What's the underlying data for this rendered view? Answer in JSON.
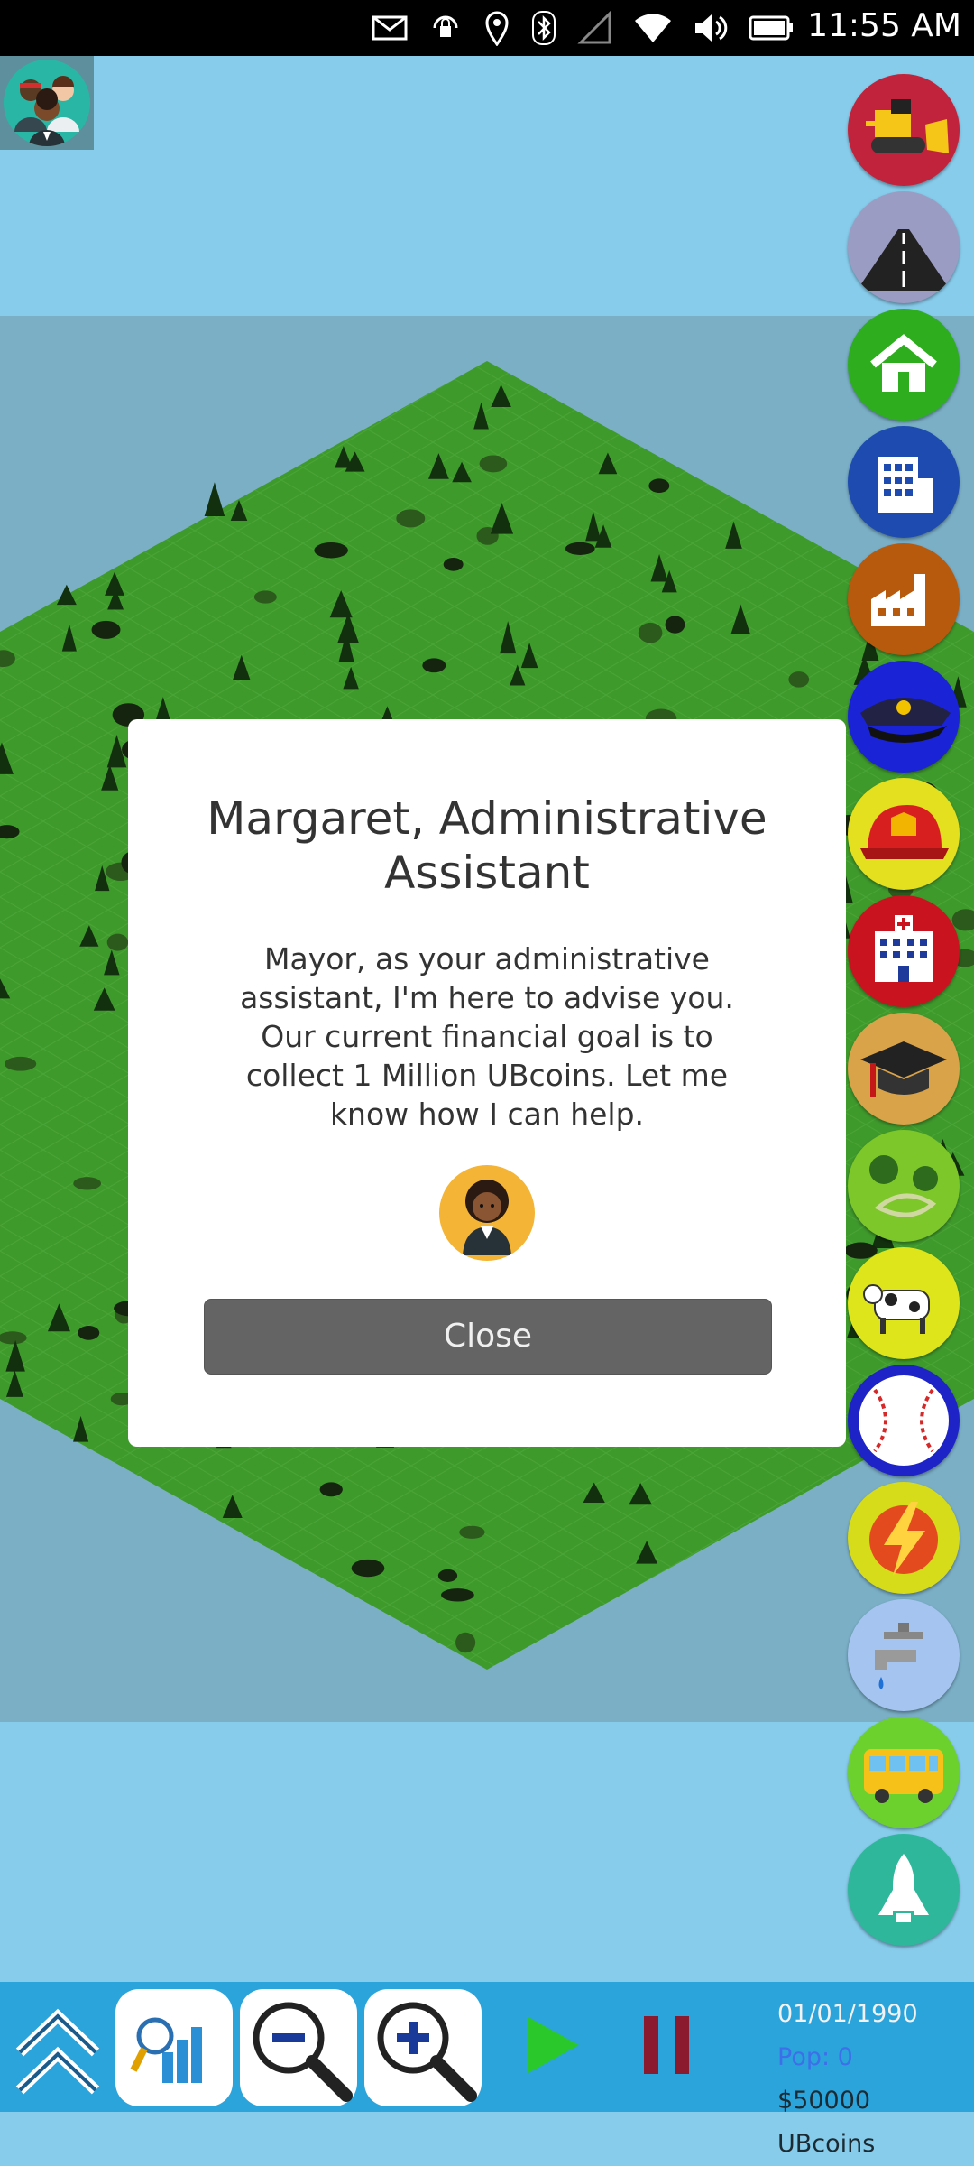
{
  "status_bar": {
    "time": "11:55 AM",
    "icons": [
      "mail-icon",
      "rotation-lock-icon",
      "location-icon",
      "bluetooth-icon",
      "cell-signal-icon",
      "wifi-icon",
      "volume-icon",
      "battery-icon"
    ]
  },
  "advisor_button": {
    "icon": "advisors-group-icon"
  },
  "tools": [
    {
      "name": "bulldozer",
      "color": "#c0233b"
    },
    {
      "name": "road",
      "color": "#9b9cc3"
    },
    {
      "name": "residential",
      "color": "#2eae1f"
    },
    {
      "name": "commercial",
      "color": "#1e4bb0"
    },
    {
      "name": "industrial",
      "color": "#b75a0e"
    },
    {
      "name": "police",
      "color": "#1a23d6"
    },
    {
      "name": "fire-department",
      "color": "#e4df1f"
    },
    {
      "name": "hospital",
      "color": "#c91420"
    },
    {
      "name": "school",
      "color": "#d9a34a"
    },
    {
      "name": "park",
      "color": "#7dc72a"
    },
    {
      "name": "farm",
      "color": "#dfe51b"
    },
    {
      "name": "stadium",
      "color": "#1d23c7"
    },
    {
      "name": "power",
      "color": "#d7dc1a"
    },
    {
      "name": "water",
      "color": "#a6c4f0"
    },
    {
      "name": "transit",
      "color": "#6cd12d"
    },
    {
      "name": "space",
      "color": "#2eb79b"
    }
  ],
  "dialog": {
    "title": "Margaret, Administrative Assistant",
    "message": "Mayor, as your administrative assistant, I'm here to advise you. Our current financial goal is to collect 1 Million UBcoins. Let me know how I can help.",
    "portrait": "margaret-portrait-icon",
    "close_label": "Close"
  },
  "bottom_bar": {
    "buttons": [
      "collapse-chevrons-icon",
      "stats-magnifier-icon",
      "zoom-out-icon",
      "zoom-in-icon",
      "play-icon",
      "pause-icon"
    ],
    "date": "01/01/1990",
    "population": "Pop: 0",
    "money": "$50000 UBcoins"
  },
  "colors": {
    "sky": "#87cceb",
    "water": "#7aafc6",
    "grass": "#3f9a2c",
    "toolbar": "#2ba4dc",
    "close_button": "#646464"
  }
}
